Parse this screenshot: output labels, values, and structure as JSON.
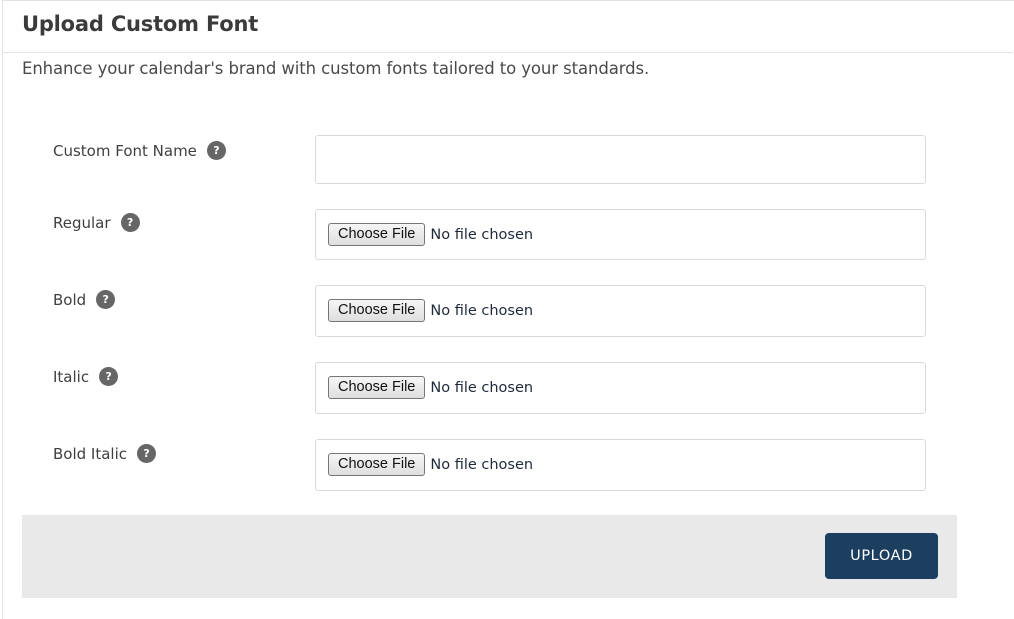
{
  "header": {
    "title": "Upload Custom Font",
    "subtitle": "Enhance your calendar's brand with custom fonts tailored to your standards."
  },
  "help_icon_glyph": "?",
  "form": {
    "font_name": {
      "label": "Custom Font Name",
      "value": "",
      "placeholder": ""
    },
    "files": [
      {
        "label": "Regular",
        "button_label": "Choose File",
        "status": "No file chosen"
      },
      {
        "label": "Bold",
        "button_label": "Choose File",
        "status": "No file chosen"
      },
      {
        "label": "Italic",
        "button_label": "Choose File",
        "status": "No file chosen"
      },
      {
        "label": "Bold Italic",
        "button_label": "Choose File",
        "status": "No file chosen"
      }
    ]
  },
  "footer": {
    "upload_label": "UPLOAD"
  },
  "colors": {
    "primary_button": "#1c3f60",
    "footer_bg": "#e9e9e9",
    "help_icon": "#666666"
  },
  "icons": {
    "help": "help-icon"
  }
}
